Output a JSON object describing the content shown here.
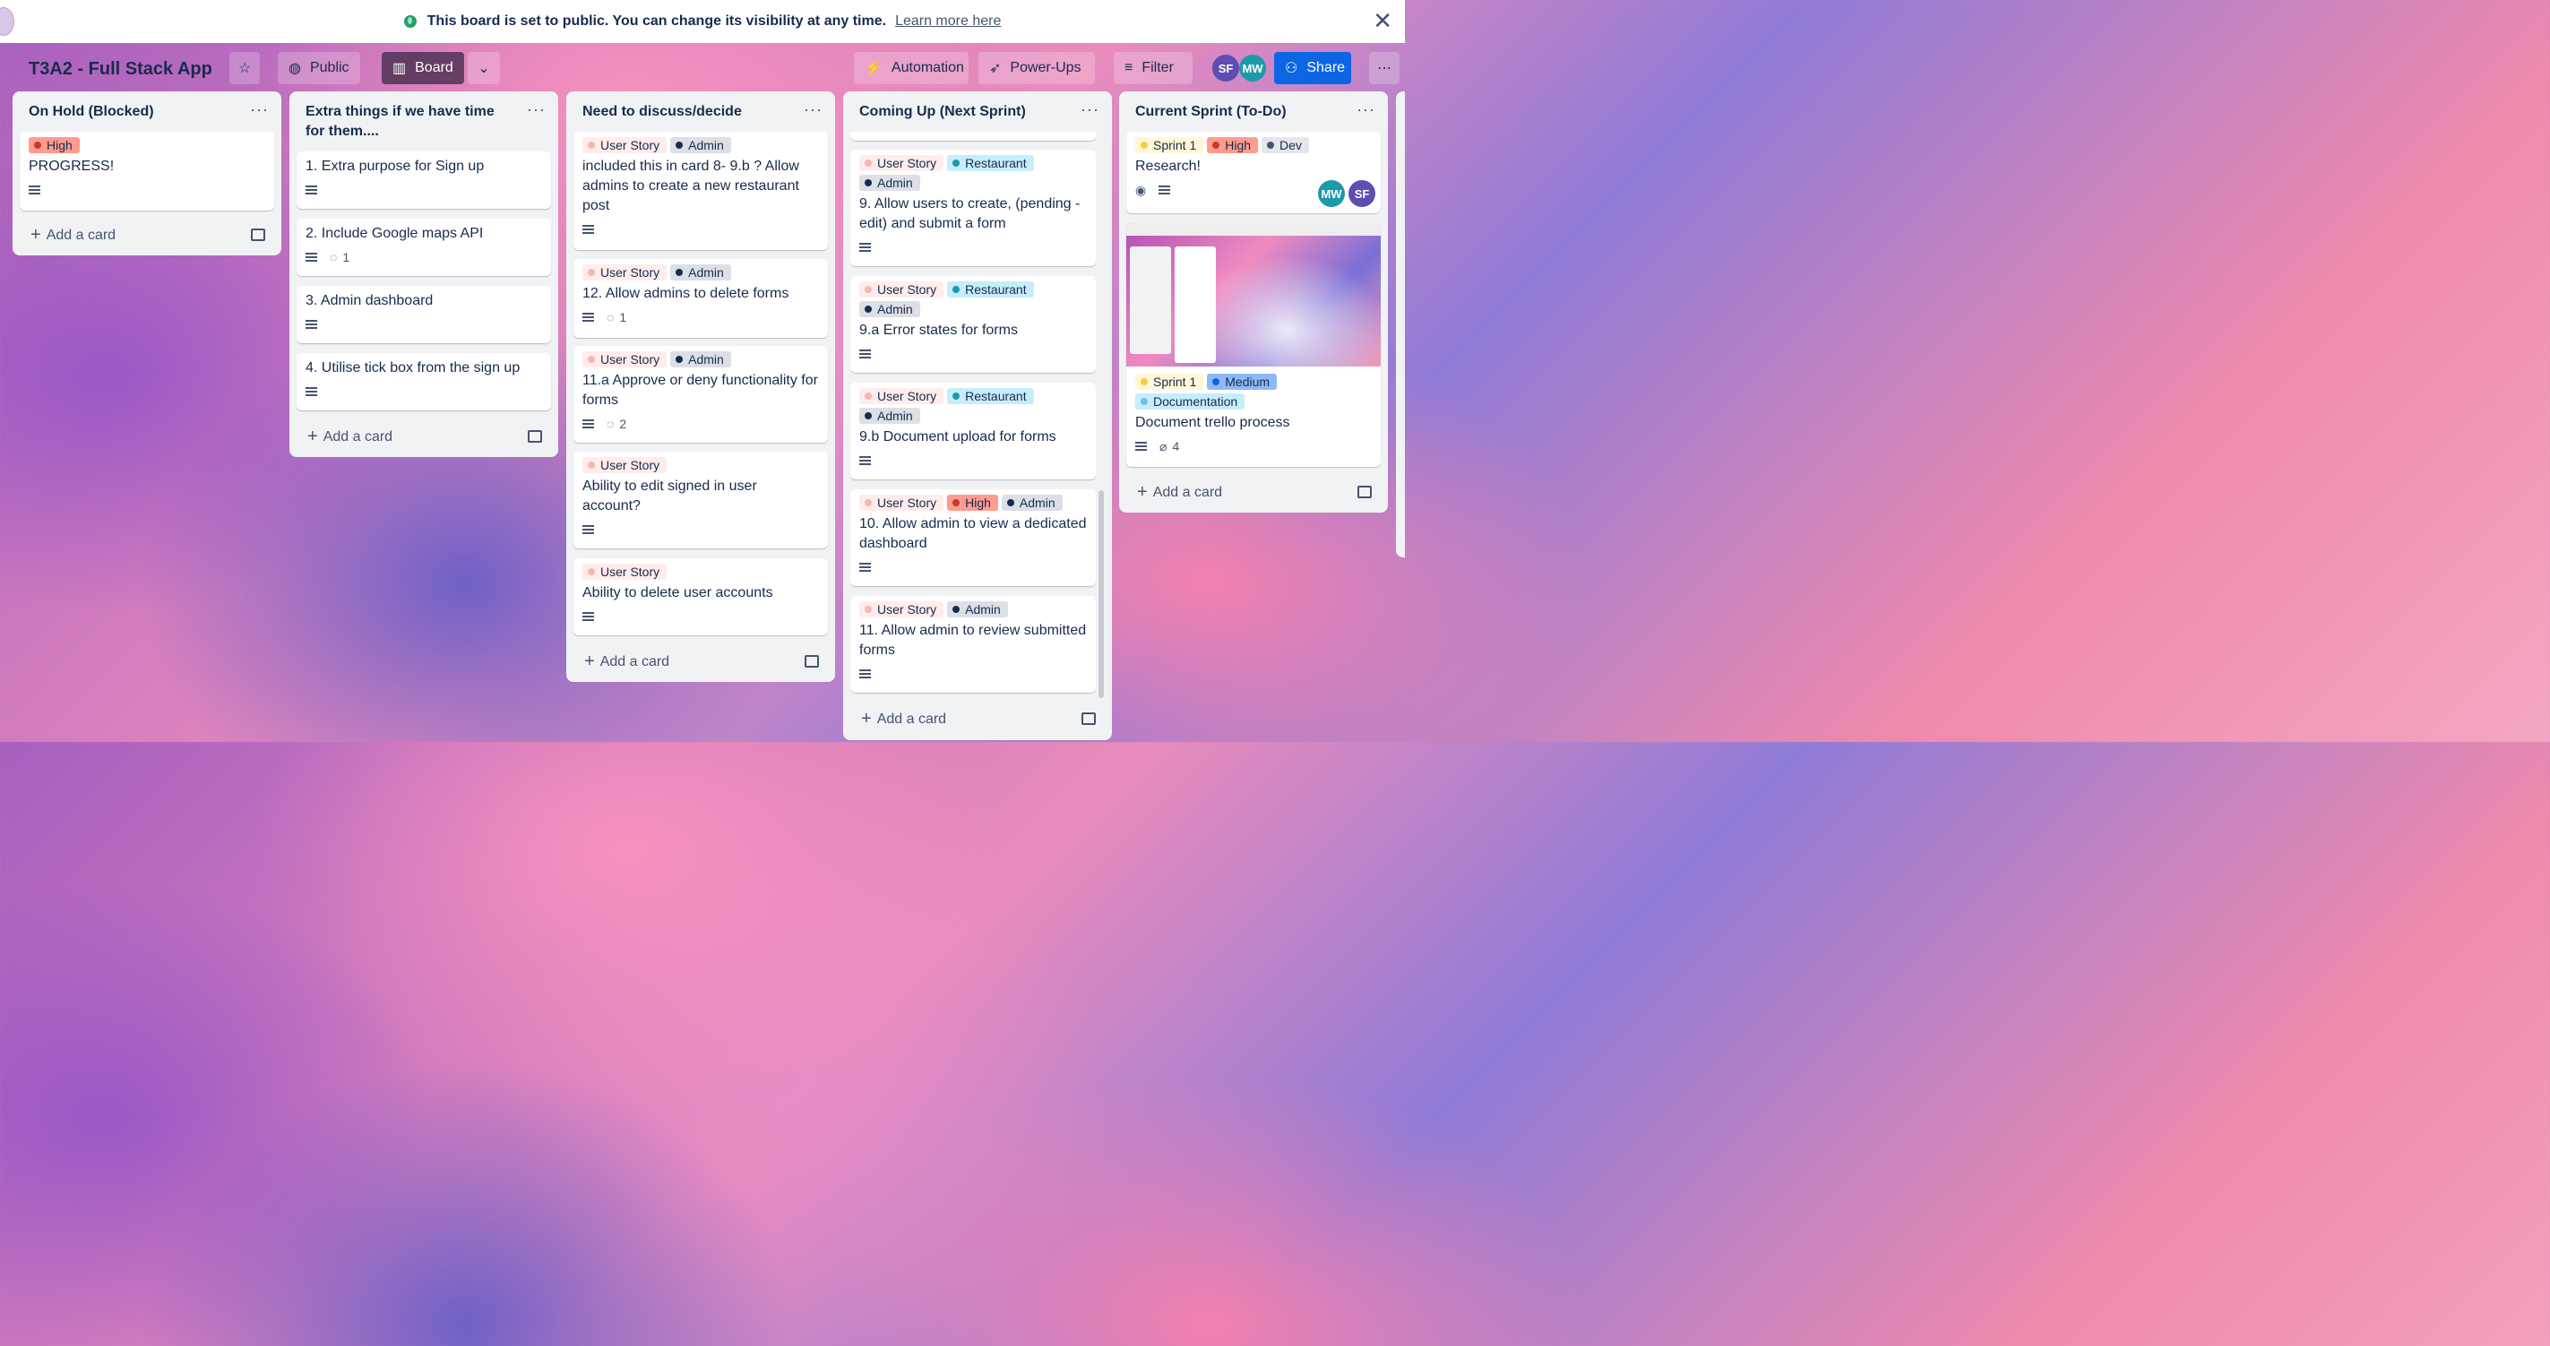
{
  "banner": {
    "text": "This board is set to public. You can change its visibility at any time.",
    "link": "Learn more here",
    "close": "✕"
  },
  "header": {
    "title": "T3A2 - Full Stack App",
    "visibility": "Public",
    "view": "Board",
    "automation": "Automation",
    "powerups": "Power-Ups",
    "filter": "Filter",
    "members": [
      "SF",
      "MW"
    ],
    "share": "Share"
  },
  "add_card": "Add a card",
  "lists": [
    {
      "title": "On Hold (Blocked)",
      "cards": [
        {
          "labels": [
            "High"
          ],
          "title": "PROGRESS!",
          "comments": ""
        }
      ]
    },
    {
      "title": "Extra things if we have time for them....",
      "cards": [
        {
          "title": "1. Extra purpose for Sign up"
        },
        {
          "title": "2. Include Google maps API",
          "comments": "1"
        },
        {
          "title": "3. Admin dashboard"
        },
        {
          "title": "4. Utilise tick box from the sign up"
        }
      ]
    },
    {
      "title": "Need to discuss/decide",
      "cards": [
        {
          "labels": [
            "User Story",
            "Admin"
          ],
          "title": "included this in card 8- 9.b ? Allow admins to create a new restaurant post"
        },
        {
          "labels": [
            "User Story",
            "Admin"
          ],
          "title": "12. Allow admins to delete forms",
          "comments": "1"
        },
        {
          "labels": [
            "User Story",
            "Admin"
          ],
          "title": "11.a Approve or deny functionality for forms",
          "comments": "2"
        },
        {
          "labels": [
            "User Story"
          ],
          "title": "Ability to edit signed in user account?"
        },
        {
          "labels": [
            "User Story"
          ],
          "title": "Ability to delete user accounts"
        }
      ]
    },
    {
      "title": "Coming Up (Next Sprint)",
      "cards": [
        {
          "labels": [
            "User Story",
            "Restaurant",
            "Admin"
          ],
          "title": "9. Allow users to create, (pending - edit) and submit a form"
        },
        {
          "labels": [
            "User Story",
            "Restaurant",
            "Admin"
          ],
          "title": "9.a Error states for forms"
        },
        {
          "labels": [
            "User Story",
            "Restaurant",
            "Admin"
          ],
          "title": "9.b Document upload for forms"
        },
        {
          "labels": [
            "User Story",
            "High",
            "Admin"
          ],
          "title": "10. Allow admin to view a dedicated dashboard"
        },
        {
          "labels": [
            "User Story",
            "Admin"
          ],
          "title": "11. Allow admin to review submitted forms"
        }
      ]
    },
    {
      "title": "Current Sprint (To-Do)",
      "cards": [
        {
          "labels": [
            "Sprint 1",
            "High",
            "Dev"
          ],
          "title": "Research!",
          "members": [
            "MW",
            "SF"
          ]
        },
        {
          "labels": [
            "Sprint 1",
            "Medium",
            "Documentation"
          ],
          "title": "Document trello process",
          "attachments": "4"
        }
      ]
    }
  ],
  "colors": {
    "share": "#0c66e4",
    "user_story": "#ffeceb",
    "admin": "#dcdfe4",
    "restaurant": "#c6edfb",
    "high": "#ff9c8f",
    "medium": "#8fb8f6"
  }
}
